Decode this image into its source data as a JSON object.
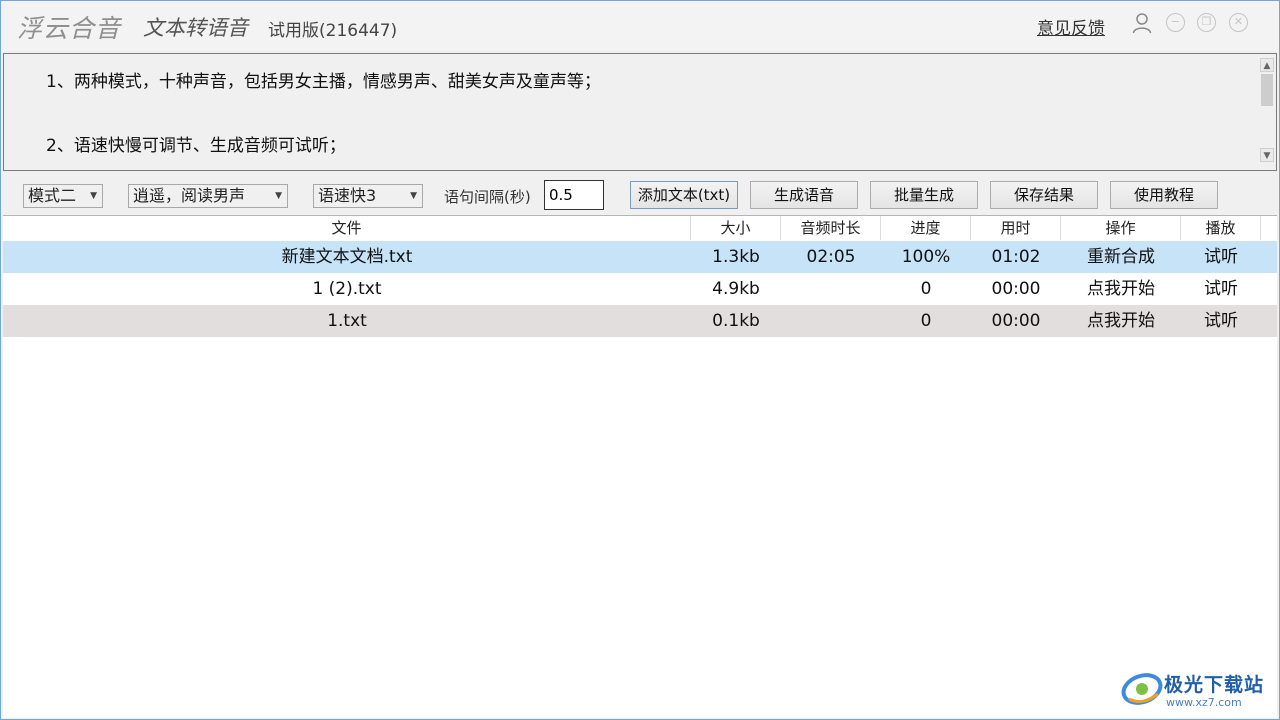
{
  "titlebar": {
    "brand": "浮云合音",
    "subtitle": "文本转语音",
    "edition": "试用版(216447)",
    "feedback": "意见反馈",
    "icons": [
      "user-icon",
      "minimize-icon",
      "restore-icon",
      "close-icon"
    ]
  },
  "text_area": {
    "line1": "1、两种模式，十种声音，包括男女主播，情感男声、甜美女声及童声等；",
    "line2": "2、语速快慢可调节、生成音频可试听；"
  },
  "toolbar": {
    "mode": "模式二",
    "voice": "逍遥，阅读男声",
    "speed": "语速快3",
    "interval_label": "语句间隔(秒)",
    "interval_value": "0.5",
    "add_text": "添加文本(txt)",
    "generate": "生成语音",
    "batch": "批量生成",
    "save": "保存结果",
    "tutorial": "使用教程"
  },
  "table": {
    "headers": [
      "文件",
      "大小",
      "音频时长",
      "进度",
      "用时",
      "操作",
      "播放"
    ],
    "rows": [
      {
        "file": "新建文本文档.txt",
        "size": "1.3kb",
        "duration": "02:05",
        "progress": "100%",
        "time": "01:02",
        "action": "重新合成",
        "play": "试听"
      },
      {
        "file": "1 (2).txt",
        "size": "4.9kb",
        "duration": "",
        "progress": "0",
        "time": "00:00",
        "action": "点我开始",
        "play": "试听"
      },
      {
        "file": "1.txt",
        "size": "0.1kb",
        "duration": "",
        "progress": "0",
        "time": "00:00",
        "action": "点我开始",
        "play": "试听"
      }
    ]
  },
  "watermark": {
    "name": "极光下载站",
    "url": "www.xz7.com"
  },
  "colors": {
    "selected_row": "#c7e3f8",
    "alt_row": "#e2dedd",
    "window_border": "#6fa8d6",
    "watermark": "#1f5fa8"
  }
}
